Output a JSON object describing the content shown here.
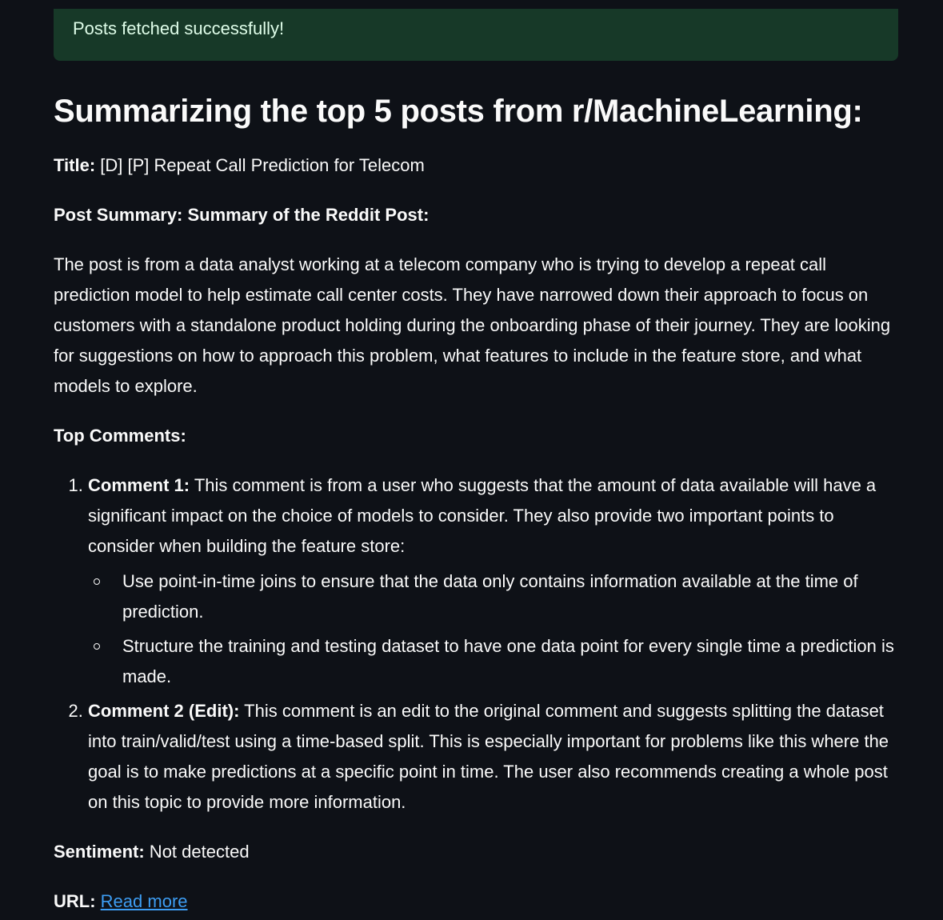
{
  "alert": {
    "message": "Posts fetched successfully!"
  },
  "heading": "Summarizing the top 5 posts from r/MachineLearning:",
  "post": {
    "title_label": "Title:",
    "title": " [D] [P] Repeat Call Prediction for Telecom",
    "summary_label": "Post Summary: Summary of the Reddit Post:",
    "summary": "The post is from a data analyst working at a telecom company who is trying to develop a repeat call prediction model to help estimate call center costs. They have narrowed down their approach to focus on customers with a standalone product holding during the onboarding phase of their journey. They are looking for suggestions on how to approach this problem, what features to include in the feature store, and what models to explore.",
    "top_comments_label": "Top Comments:",
    "comments": [
      {
        "label": "Comment 1:",
        "text": " This comment is from a user who suggests that the amount of data available will have a significant impact on the choice of models to consider. They also provide two important points to consider when building the feature store:",
        "points": [
          "Use point-in-time joins to ensure that the data only contains information available at the time of prediction.",
          "Structure the training and testing dataset to have one data point for every single time a prediction is made."
        ]
      },
      {
        "label": "Comment 2 (Edit):",
        "text": " This comment is an edit to the original comment and suggests splitting the dataset into train/valid/test using a time-based split. This is especially important for problems like this where the goal is to make predictions at a specific point in time. The user also recommends creating a whole post on this topic to provide more information."
      }
    ],
    "sentiment_label": "Sentiment:",
    "sentiment": " Not detected",
    "url_label": "URL:",
    "url_link_text": "Read more"
  }
}
